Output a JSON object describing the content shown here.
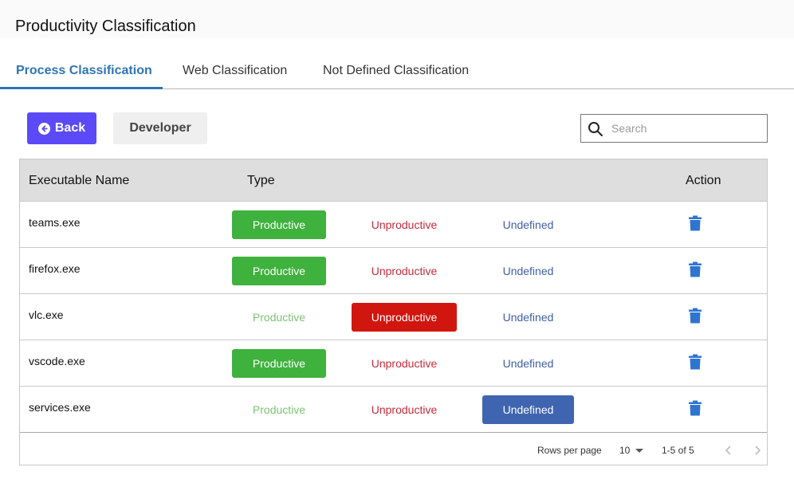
{
  "header": {
    "title": "Productivity Classification"
  },
  "tabs": [
    {
      "label": "Process Classification",
      "active": true
    },
    {
      "label": "Web Classification",
      "active": false
    },
    {
      "label": "Not Defined Classification",
      "active": false
    }
  ],
  "toolbar": {
    "back_label": "Back",
    "developer_label": "Developer"
  },
  "search": {
    "placeholder": "Search",
    "value": ""
  },
  "table": {
    "columns": [
      "Executable Name",
      "Type",
      "Action"
    ],
    "type_options": [
      "Productive",
      "Unproductive",
      "Undefined"
    ],
    "rows": [
      {
        "name": "teams.exe",
        "selected": "Productive"
      },
      {
        "name": "firefox.exe",
        "selected": "Productive"
      },
      {
        "name": "vlc.exe",
        "selected": "Unproductive"
      },
      {
        "name": "vscode.exe",
        "selected": "Productive"
      },
      {
        "name": "services.exe",
        "selected": "Undefined"
      }
    ]
  },
  "pagination": {
    "rows_per_page_label": "Rows per page",
    "rows_per_page": "10",
    "range": "1-5 of 5"
  },
  "icons": {
    "back": "arrow-left-circle-icon",
    "search": "search-icon",
    "delete": "trash-icon",
    "prev": "chevron-left-icon",
    "next": "chevron-right-icon"
  },
  "colors": {
    "accent": "#2f74b5",
    "back_button": "#5b4af5",
    "productive": "#3fb13d",
    "unproductive": "#d0160f",
    "undefined": "#3f64b0",
    "delete_icon": "#2f74d0"
  }
}
